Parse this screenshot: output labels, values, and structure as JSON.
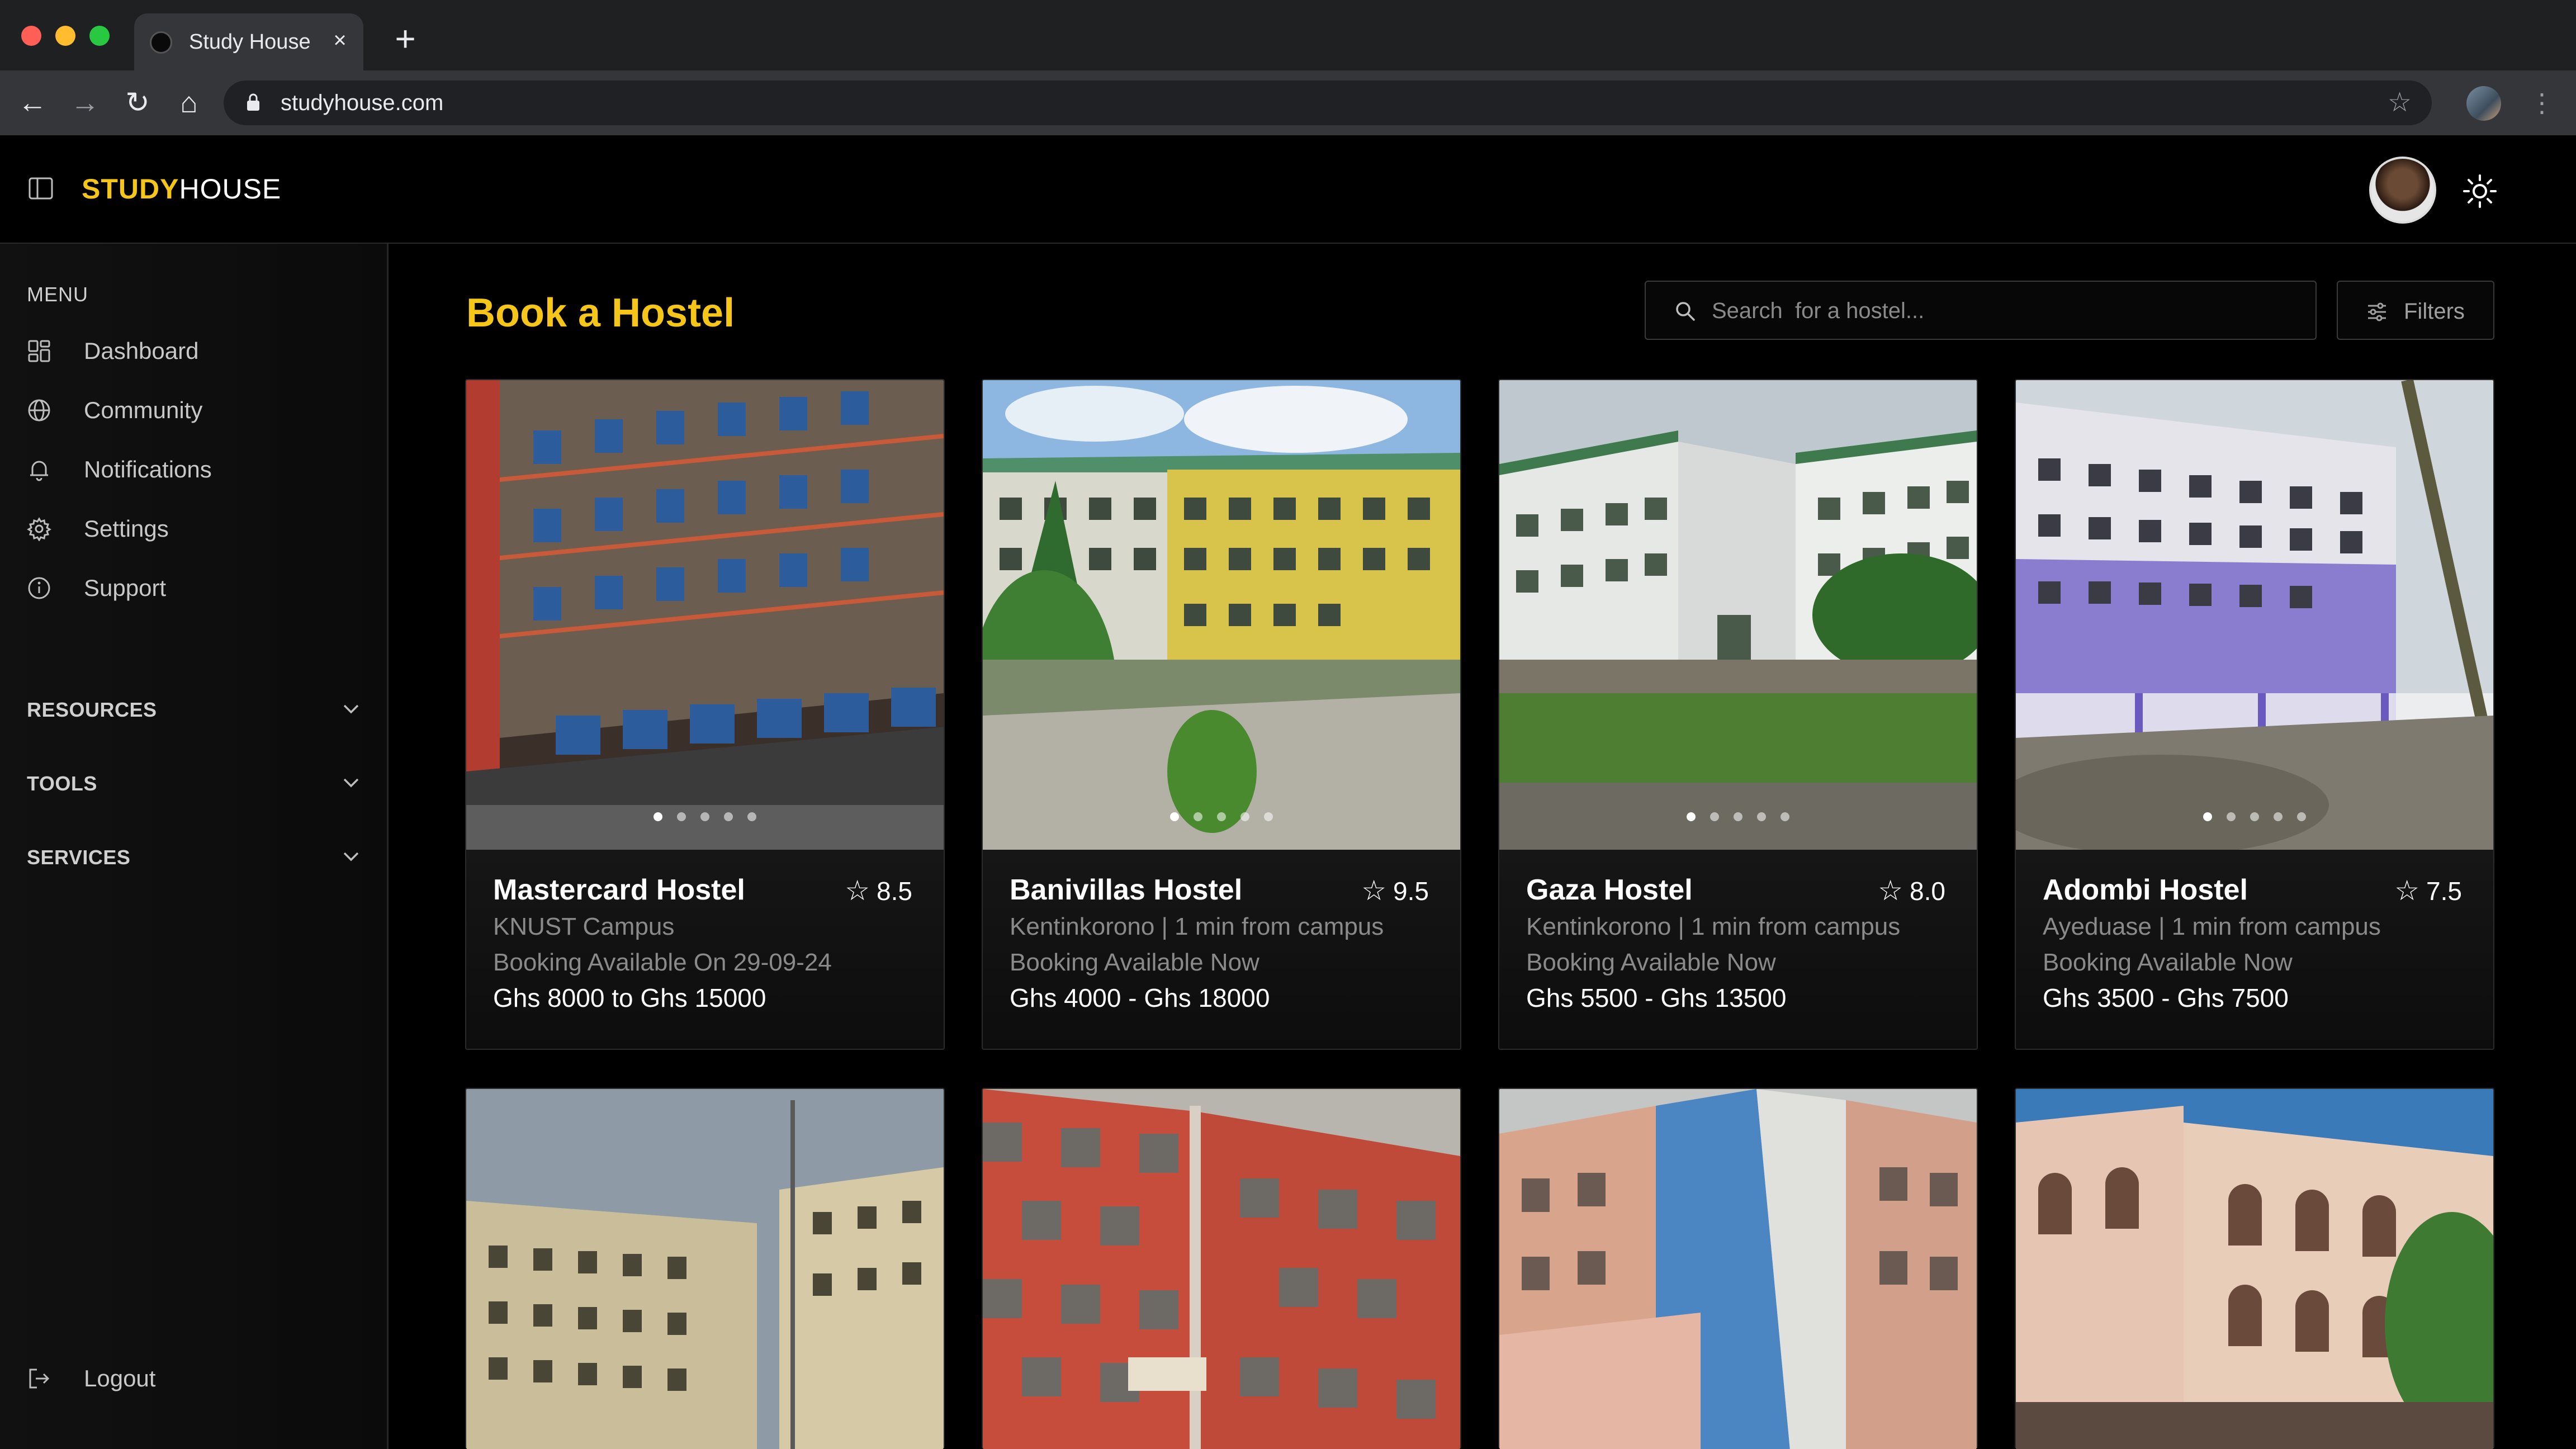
{
  "browser": {
    "tab_title": "Study House",
    "close_glyph": "×",
    "new_tab_glyph": "+",
    "url": "studyhouse.com",
    "back_glyph": "←",
    "forward_glyph": "→",
    "reload_glyph": "↻",
    "home_glyph": "⌂",
    "bookmark_glyph": "☆",
    "menu_glyph": "⋮"
  },
  "header": {
    "brand_bold": "STUDY",
    "brand_light": "HOUSE"
  },
  "sidebar": {
    "menu_label": "MENU",
    "items": [
      {
        "label": "Dashboard",
        "icon": "dashboard-icon"
      },
      {
        "label": "Community",
        "icon": "globe-icon"
      },
      {
        "label": "Notifications",
        "icon": "bell-icon"
      },
      {
        "label": "Settings",
        "icon": "gear-icon"
      },
      {
        "label": "Support",
        "icon": "info-icon"
      }
    ],
    "sections": [
      {
        "label": "RESOURCES"
      },
      {
        "label": "TOOLS"
      },
      {
        "label": "SERVICES"
      }
    ],
    "logout_label": "Logout"
  },
  "main": {
    "title": "Book a Hostel",
    "search_placeholder": "Search  for a hostel...",
    "filters_label": "Filters",
    "cards": [
      {
        "name": "Mastercard Hostel",
        "rating": "8.5",
        "location": "KNUST Campus",
        "availability": "Booking Available On 29-09-24",
        "price": "Ghs 8000 to Ghs 15000"
      },
      {
        "name": "Banivillas Hostel",
        "rating": "9.5",
        "location": "Kentinkorono | 1 min from campus",
        "availability": "Booking Available Now",
        "price": "Ghs 4000 - Ghs 18000"
      },
      {
        "name": "Gaza Hostel",
        "rating": "8.0",
        "location": "Kentinkorono | 1 min from campus",
        "availability": "Booking Available Now",
        "price": "Ghs 5500 - Ghs 13500"
      },
      {
        "name": "Adombi Hostel",
        "rating": "7.5",
        "location": "Ayeduase | 1 min from campus",
        "availability": "Booking Available Now",
        "price": "Ghs 3500 - Ghs 7500"
      }
    ],
    "star_glyph": "☆"
  },
  "colors": {
    "accent": "#f5c518",
    "background": "#000000",
    "card": "#141414"
  }
}
